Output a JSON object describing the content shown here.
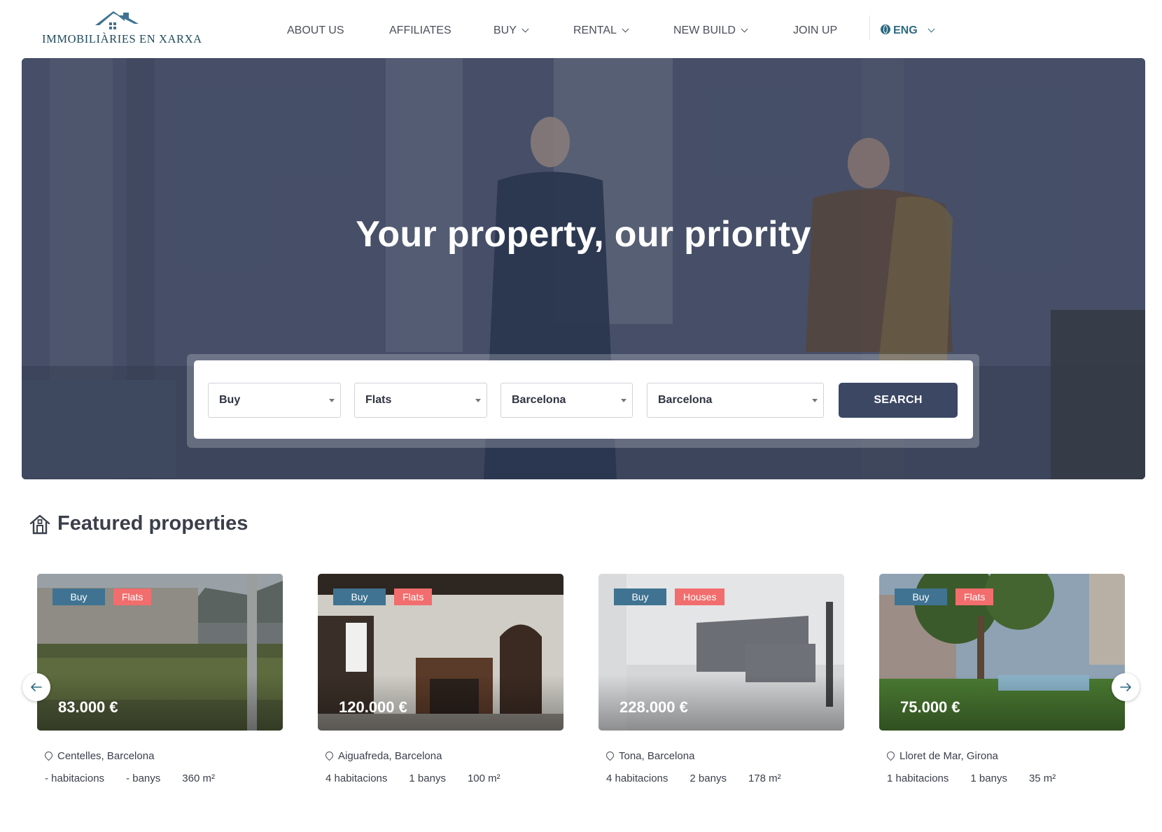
{
  "header": {
    "logo_text": "IMMOBILIÀRIES EN XARXA",
    "nav": [
      {
        "label": "ABOUT US",
        "has_dropdown": false
      },
      {
        "label": "AFFILIATES",
        "has_dropdown": false
      },
      {
        "label": "BUY",
        "has_dropdown": true
      },
      {
        "label": "RENTAL",
        "has_dropdown": true
      },
      {
        "label": "NEW BUILD",
        "has_dropdown": true
      },
      {
        "label": "JOIN UP",
        "has_dropdown": false
      }
    ],
    "language": "ENG"
  },
  "hero": {
    "title": "Your property, our priority",
    "search": {
      "operation": "Buy",
      "type": "Flats",
      "province": "Barcelona",
      "city": "Barcelona",
      "button": "SEARCH"
    }
  },
  "featured": {
    "title": "Featured properties",
    "cards": [
      {
        "operation": "Buy",
        "type": "Flats",
        "price": "83.000 €",
        "location": "Centelles, Barcelona",
        "rooms": "- habitacions",
        "baths": "- banys",
        "area": "360 m²"
      },
      {
        "operation": "Buy",
        "type": "Flats",
        "price": "120.000 €",
        "location": "Aiguafreda, Barcelona",
        "rooms": "4 habitacions",
        "baths": "1 banys",
        "area": "100 m²"
      },
      {
        "operation": "Buy",
        "type": "Houses",
        "price": "228.000 €",
        "location": "Tona, Barcelona",
        "rooms": "4 habitacions",
        "baths": "2 banys",
        "area": "178 m²"
      },
      {
        "operation": "Buy",
        "type": "Flats",
        "price": "75.000 €",
        "location": "Lloret de Mar, Girona",
        "rooms": "1 habitacions",
        "baths": "1 banys",
        "area": "35 m²"
      }
    ]
  },
  "colors": {
    "primary": "#3b4763",
    "brand": "#2d6b82",
    "badge_operation": "#3f7391",
    "badge_type": "#f26d6d"
  }
}
